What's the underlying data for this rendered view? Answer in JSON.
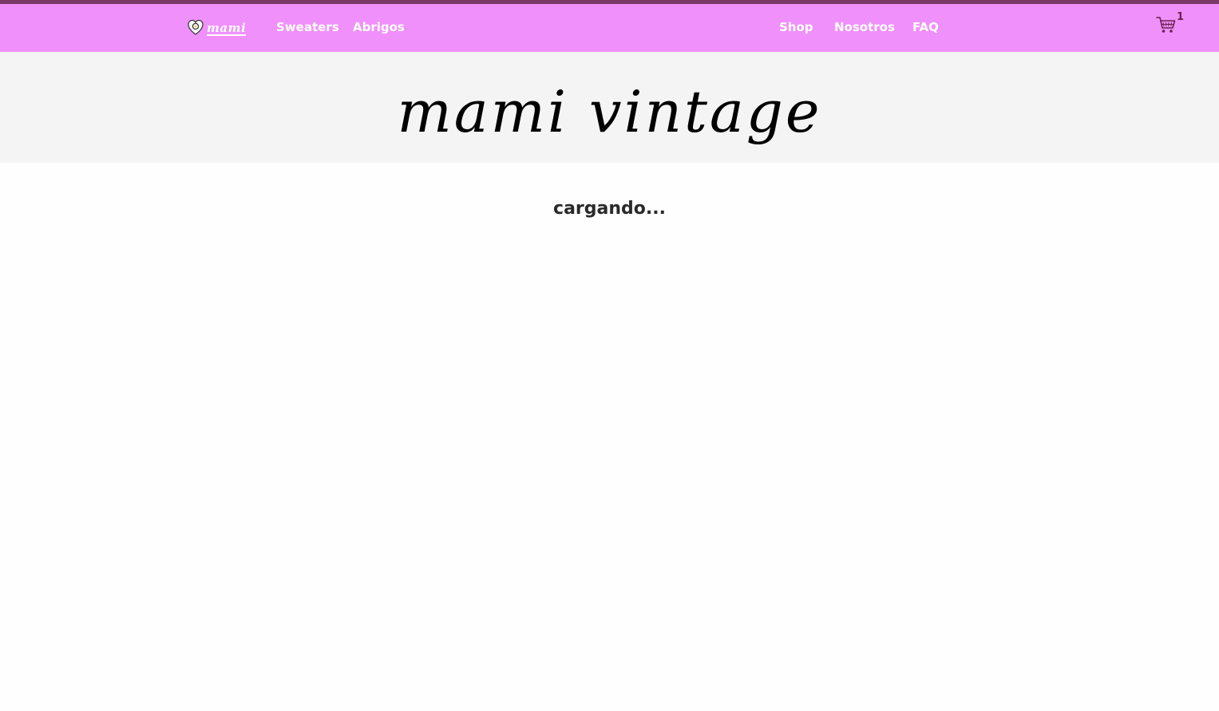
{
  "brand": {
    "logo_text": "mami",
    "logo_icon": "fried-egg-heart-icon"
  },
  "nav": {
    "left_links": [
      {
        "label": "Sweaters"
      },
      {
        "label": "Abrigos"
      }
    ],
    "right_links": [
      {
        "label": "Shop"
      },
      {
        "label": "Nosotros"
      },
      {
        "label": "FAQ"
      }
    ],
    "cart": {
      "icon": "shopping-cart-icon",
      "count": "1"
    }
  },
  "hero": {
    "title": "mami vintage"
  },
  "main": {
    "status_text": "cargando..."
  },
  "colors": {
    "topline": "#7b3a66",
    "navbar": "#f090fb",
    "hero_bg": "#f4f4f4",
    "nav_text": "#ffffff",
    "cart_count": "#6d1f4f"
  }
}
